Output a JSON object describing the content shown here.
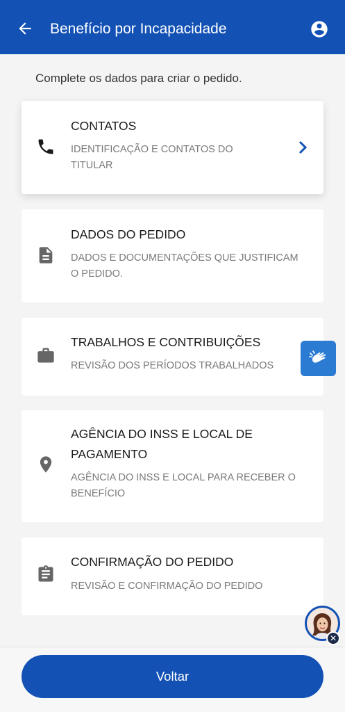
{
  "header": {
    "title": "Benefício por Incapacidade",
    "back_icon": "arrow-left-icon",
    "profile_icon": "account-circle-icon"
  },
  "subtitle": "Complete os dados para criar o pedido.",
  "steps": [
    {
      "title": "CONTATOS",
      "description": "IDENTIFICAÇÃO E CONTATOS DO TITULAR",
      "icon": "phone-icon"
    },
    {
      "title": "DADOS DO PEDIDO",
      "description": "DADOS E DOCUMENTAÇÕES QUE JUSTIFICAM O PEDIDO.",
      "icon": "document-icon"
    },
    {
      "title": "TRABALHOS E CONTRIBUIÇÕES",
      "description": "REVISÃO DOS PERÍODOS TRABALHADOS",
      "icon": "briefcase-icon"
    },
    {
      "title": "AGÊNCIA DO INSS E LOCAL DE PAGAMENTO",
      "description": "AGÊNCIA DO INSS E LOCAL PARA RECEBER O BENEFÍCIO",
      "icon": "location-pin-icon"
    },
    {
      "title": "CONFIRMAÇÃO DO PEDIDO",
      "description": "REVISÃO E CONFIRMAÇÃO DO PEDIDO",
      "icon": "clipboard-icon"
    }
  ],
  "footer": {
    "back_button": "Voltar"
  },
  "colors": {
    "primary": "#1351b4",
    "vlibras": "#2b7bd3"
  }
}
